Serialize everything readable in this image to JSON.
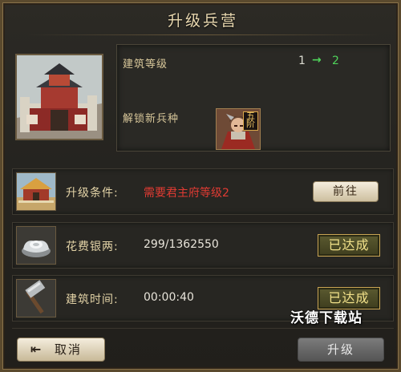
{
  "title": "升级兵营",
  "info": {
    "level_label": "建筑等级",
    "level_from": "1",
    "level_arrow": "→",
    "level_to": "2",
    "unlock_label": "解锁新兵种",
    "unit_tag": "五阶"
  },
  "conditions": [
    {
      "label": "升级条件:",
      "value": "需要君主府等级2",
      "action": "前往",
      "icon": "palace-icon"
    },
    {
      "label": "花费银两:",
      "value": "299/1362550",
      "status": "已达成",
      "icon": "silver-ingot-icon"
    },
    {
      "label": "建筑时间:",
      "value": "00:00:40",
      "status": "已达成",
      "icon": "hammer-icon"
    }
  ],
  "footer": {
    "cancel_label": "取消",
    "upgrade_label": "升级"
  },
  "watermark": "沃德下载站",
  "colors": {
    "requirement_red": "#e03b33",
    "level_green": "#4fd35a",
    "gold_text": "#f2e28a"
  }
}
